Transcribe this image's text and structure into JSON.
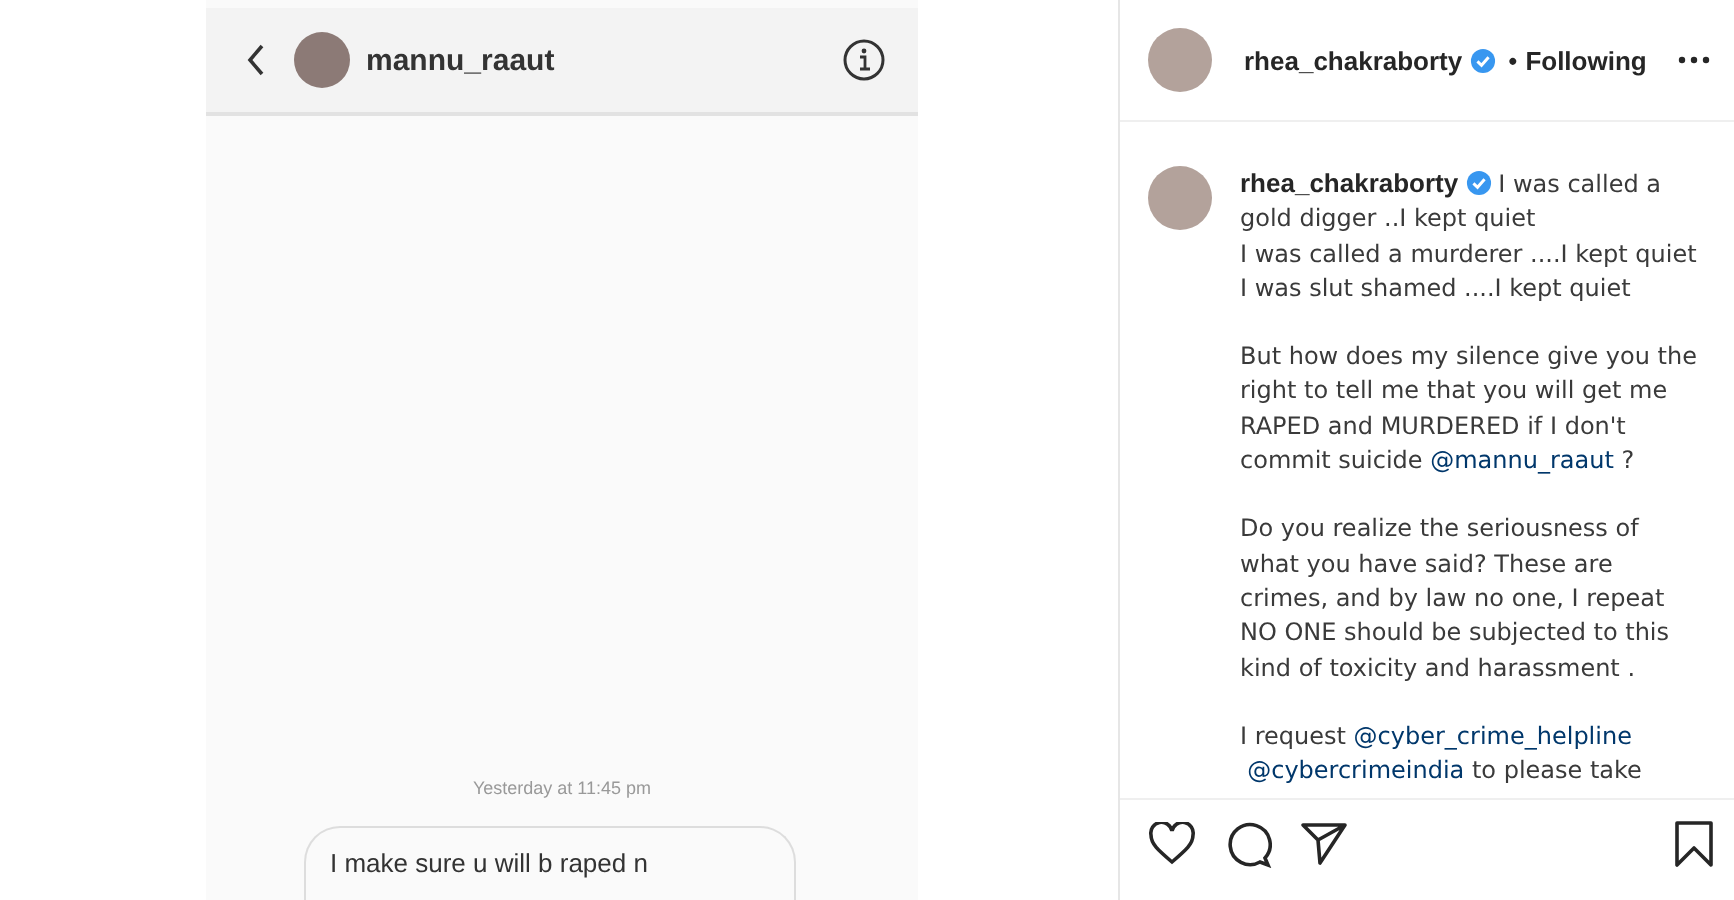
{
  "dm_screenshot": {
    "contact": {
      "username": "mannu_raaut"
    },
    "timestamp": "Yesterday at 11:45 pm",
    "messages": [
      {
        "text": "I make sure u will b raped n"
      }
    ]
  },
  "post": {
    "header": {
      "username": "rhea_chakraborty",
      "verified": true,
      "separator": "•",
      "follow_status": "Following"
    },
    "caption": {
      "username": "rhea_chakraborty",
      "verified": true,
      "paragraphs": [
        {
          "segments": [
            {
              "kind": "text",
              "text": "I was called a gold digger ..I kept quiet\nI was called a murderer ....I kept quiet\nI was slut shamed ....I kept quiet"
            }
          ]
        },
        {
          "segments": [
            {
              "kind": "text",
              "text": "But how does my silence give you the right to tell me that you will get me RAPED and MURDERED if I don't commit suicide "
            },
            {
              "kind": "mention",
              "text": "@mannu_raaut"
            },
            {
              "kind": "text",
              "text": " ?"
            }
          ]
        },
        {
          "segments": [
            {
              "kind": "text",
              "text": "Do you realize the seriousness of what you have said? These are crimes, and by law no one, I repeat NO ONE should be subjected to this kind of toxicity and harassment ."
            }
          ]
        },
        {
          "segments": [
            {
              "kind": "text",
              "text": "I request "
            },
            {
              "kind": "mention",
              "text": "@cyber_crime_helpline"
            },
            {
              "kind": "mention",
              "text": "@cybercrimeindia"
            },
            {
              "kind": "text",
              "text": " to please take"
            }
          ]
        }
      ]
    }
  }
}
